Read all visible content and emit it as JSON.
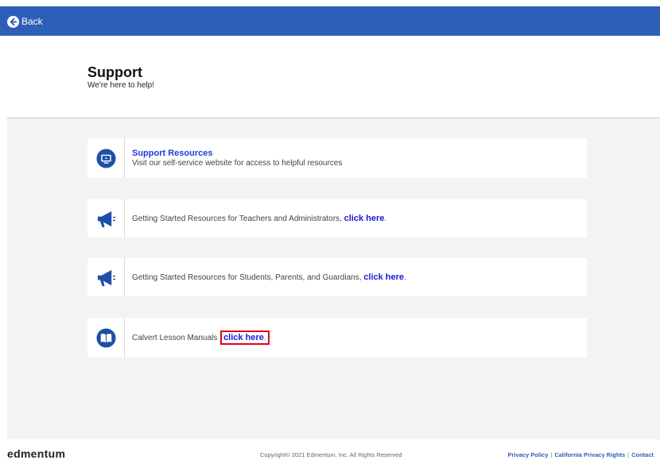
{
  "topbar": {
    "back_label": "Back",
    "color": "#2d5fb8"
  },
  "header": {
    "title": "Support",
    "subtitle": "We're here to help!"
  },
  "cards": [
    {
      "icon": "monitor-icon",
      "title": "Support Resources",
      "text": "Visit our self-service website for access to helpful resources"
    },
    {
      "icon": "megaphone-icon",
      "text": "Getting Started Resources for Teachers and Administrators, ",
      "link": "click here",
      "after": "."
    },
    {
      "icon": "megaphone-icon",
      "text": "Getting Started Resources for Students, Parents, and Guardians, ",
      "link": "click here",
      "after": "."
    },
    {
      "icon": "book-icon",
      "text": "Calvert Lesson Manuals ",
      "link": "click here",
      "after": "."
    }
  ],
  "footer": {
    "logo": "edmentum",
    "copyright": "Copyright© 2021 Edmentum, Inc. All Rights Reserved",
    "links": [
      "Privacy Policy",
      "California Privacy Rights",
      "Contact"
    ]
  },
  "colors": {
    "accent": "#2d5fb8",
    "link": "#1a1ad6",
    "highlight": "#e0001b"
  }
}
